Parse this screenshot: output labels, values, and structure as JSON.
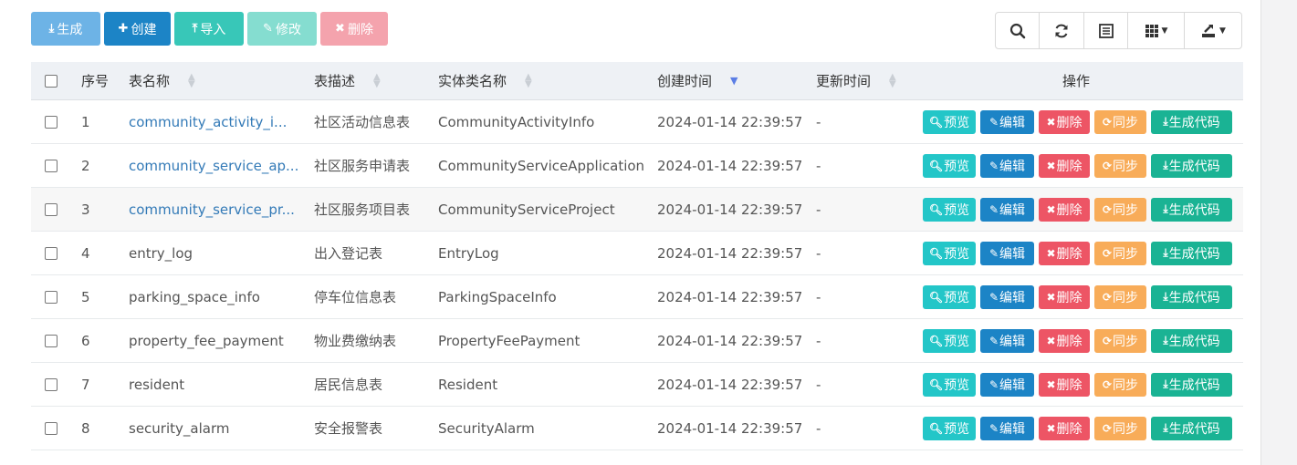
{
  "toolbar": {
    "generate": "生成",
    "create": "创建",
    "import": "导入",
    "modify": "修改",
    "delete": "删除"
  },
  "table": {
    "headers": {
      "no": "序号",
      "table_name": "表名称",
      "table_desc": "表描述",
      "class_name": "实体类名称",
      "create_time": "创建时间",
      "update_time": "更新时间",
      "actions": "操作"
    },
    "row_actions": {
      "preview": "预览",
      "edit": "编辑",
      "delete": "删除",
      "sync": "同步",
      "gen_code": "生成代码"
    },
    "rows": [
      {
        "no": "1",
        "name": "community_activity_i...",
        "desc": "社区活动信息表",
        "cls": "CommunityActivityInfo",
        "ct": "2024-01-14 22:39:57",
        "ut": "-"
      },
      {
        "no": "2",
        "name": "community_service_ap...",
        "desc": "社区服务申请表",
        "cls": "CommunityServiceApplication",
        "ct": "2024-01-14 22:39:57",
        "ut": "-"
      },
      {
        "no": "3",
        "name": "community_service_pr...",
        "desc": "社区服务项目表",
        "cls": "CommunityServiceProject",
        "ct": "2024-01-14 22:39:57",
        "ut": "-"
      },
      {
        "no": "4",
        "name": "entry_log",
        "desc": "出入登记表",
        "cls": "EntryLog",
        "ct": "2024-01-14 22:39:57",
        "ut": "-"
      },
      {
        "no": "5",
        "name": "parking_space_info",
        "desc": "停车位信息表",
        "cls": "ParkingSpaceInfo",
        "ct": "2024-01-14 22:39:57",
        "ut": "-"
      },
      {
        "no": "6",
        "name": "property_fee_payment",
        "desc": "物业费缴纳表",
        "cls": "PropertyFeePayment",
        "ct": "2024-01-14 22:39:57",
        "ut": "-"
      },
      {
        "no": "7",
        "name": "resident",
        "desc": "居民信息表",
        "cls": "Resident",
        "ct": "2024-01-14 22:39:57",
        "ut": "-"
      },
      {
        "no": "8",
        "name": "security_alarm",
        "desc": "安全报警表",
        "cls": "SecurityAlarm",
        "ct": "2024-01-14 22:39:57",
        "ut": "-"
      }
    ]
  },
  "colors": {
    "preview": "#23c6c8",
    "edit": "#1c84c6",
    "delete": "#ed5565",
    "sync": "#f8ac59",
    "gen_code": "#1ab394",
    "link": "#337ab7"
  }
}
